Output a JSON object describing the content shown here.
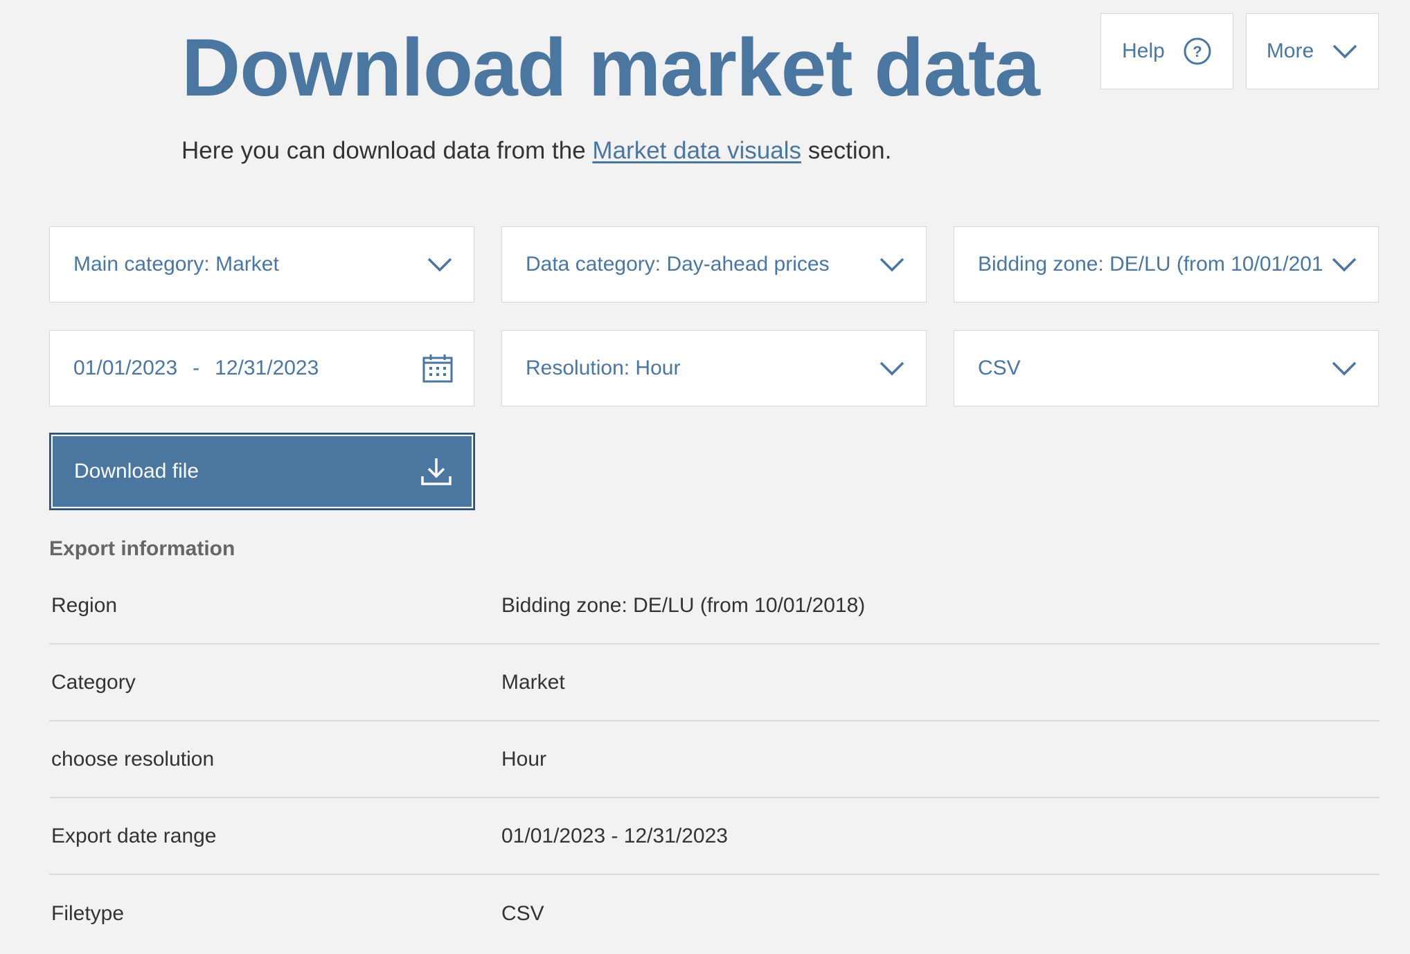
{
  "header": {
    "title": "Download market data",
    "help_label": "Help",
    "more_label": "More"
  },
  "intro": {
    "before": "Here you can download data from the",
    "link": "Market data visuals",
    "after": "section."
  },
  "filters": {
    "main_category": "Main category: Market",
    "data_category": "Data category: Day-ahead prices",
    "bidding_zone": "Bidding zone: DE/LU (from 10/01/2018)",
    "date_from": "01/01/2023",
    "date_sep": "-",
    "date_to": "12/31/2023",
    "resolution": "Resolution: Hour",
    "filetype": "CSV"
  },
  "download": {
    "label": "Download file"
  },
  "export": {
    "title": "Export information",
    "rows": [
      {
        "key": "Region",
        "value": "Bidding zone: DE/LU (from 10/01/2018)"
      },
      {
        "key": "Category",
        "value": "Market"
      },
      {
        "key": "choose resolution",
        "value": "Hour"
      },
      {
        "key": "Export date range",
        "value": "01/01/2023 - 12/31/2023"
      },
      {
        "key": "Filetype",
        "value": "CSV"
      }
    ]
  },
  "colors": {
    "accent": "#4a76a0",
    "background": "#f2f2f2",
    "text": "#333333"
  }
}
